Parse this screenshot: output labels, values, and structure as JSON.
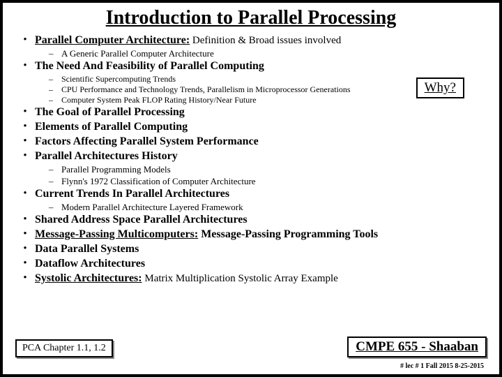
{
  "title": "Introduction to Parallel Processing",
  "items": [
    {
      "type": "main",
      "boldUnder": "Parallel Computer Architecture:",
      "rest": " Definition & Broad issues involved"
    },
    {
      "type": "sub",
      "text": "A Generic Parallel Computer Architecture"
    },
    {
      "type": "main-bold",
      "text": "The Need And Feasibility of Parallel Computing"
    },
    {
      "type": "subsub",
      "text": "Scientific Supercomputing Trends"
    },
    {
      "type": "subsub",
      "text": "CPU Performance and Technology Trends, Parallelism in Microprocessor Generations"
    },
    {
      "type": "subsub",
      "text": "Computer System Peak FLOP Rating History/Near Future"
    },
    {
      "type": "main-bold",
      "text": "The Goal of Parallel Processing"
    },
    {
      "type": "main-bold",
      "text": "Elements of Parallel Computing"
    },
    {
      "type": "main-bold",
      "text": "Factors Affecting Parallel System Performance"
    },
    {
      "type": "main-bold",
      "text": "Parallel Architectures History"
    },
    {
      "type": "sub",
      "text": "Parallel Programming Models"
    },
    {
      "type": "sub",
      "text": "Flynn's 1972 Classification of Computer Architecture"
    },
    {
      "type": "main-bold",
      "text": "Current Trends In Parallel Architectures"
    },
    {
      "type": "sub",
      "text": "Modern Parallel Architecture Layered Framework"
    },
    {
      "type": "main-bold",
      "text": "Shared Address Space Parallel Architectures"
    },
    {
      "type": "main",
      "boldUnder": "Message-Passing Multicomputers:",
      "boldRest": " Message-Passing Programming Tools"
    },
    {
      "type": "main-bold",
      "text": "Data Parallel Systems"
    },
    {
      "type": "main-bold",
      "text": "Dataflow Architectures"
    },
    {
      "type": "main",
      "boldUnder": "Systolic Architectures:",
      "rest": " Matrix Multiplication Systolic Array Example"
    }
  ],
  "why": "Why?",
  "pca": "PCA Chapter 1.1, 1.2",
  "course": "CMPE 655 - Shaaban",
  "meta": "#  lec # 1   Fall 2015   8-25-2015"
}
